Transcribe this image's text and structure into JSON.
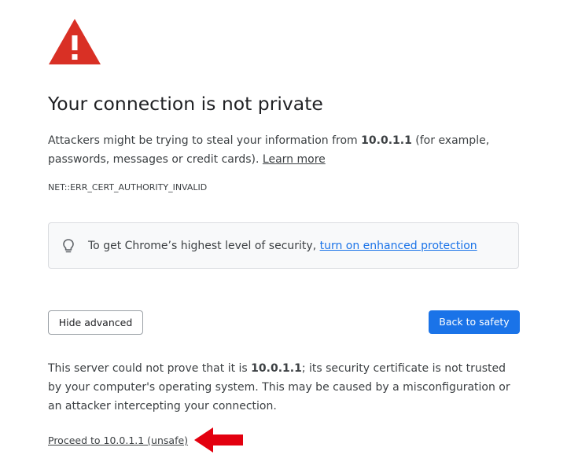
{
  "page": {
    "title": "Your connection is not private",
    "intro_before": "Attackers might be trying to steal your information from ",
    "intro_host": "10.0.1.1",
    "intro_after": " (for example, passwords, messages or credit cards). ",
    "learn_more": "Learn more",
    "error_code": "NET::ERR_CERT_AUTHORITY_INVALID"
  },
  "enhanced": {
    "text": "To get Chrome’s highest level of security, ",
    "link": "turn on enhanced protection",
    "icon": "lightbulb-icon"
  },
  "buttons": {
    "hide_advanced": "Hide advanced",
    "back_to_safety": "Back to safety"
  },
  "details": {
    "before": "This server could not prove that it is ",
    "host": "10.0.1.1",
    "after": "; its security certificate is not trusted by your computer's operating system. This may be caused by a misconfiguration or an attacker intercepting your connection."
  },
  "proceed_link": "Proceed to 10.0.1.1 (unsafe)",
  "icons": {
    "warning": "warning-triangle-icon",
    "annotation": "red-arrow-annotation"
  },
  "colors": {
    "warning_red": "#d93025",
    "primary_blue": "#1a73e8",
    "annotation_red": "#e3000f"
  }
}
